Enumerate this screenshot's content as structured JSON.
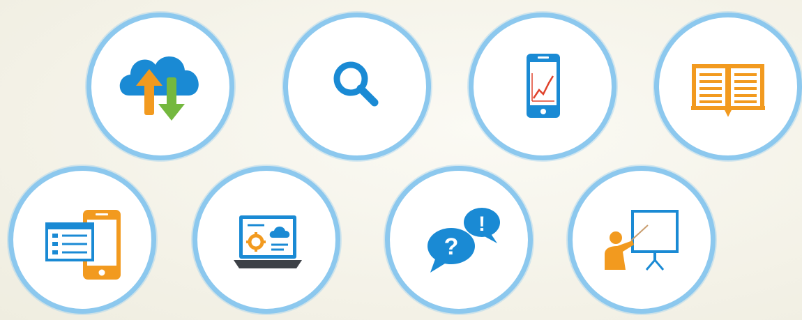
{
  "colors": {
    "background": "#f6f4ec",
    "ring": "#8cc8ee",
    "blue": "#1a8ad4",
    "orange": "#f29a1f",
    "green": "#74b83f",
    "red": "#e0422b",
    "dark": "#3d4147"
  },
  "icons": [
    {
      "name": "cloud-sync-icon"
    },
    {
      "name": "search-icon"
    },
    {
      "name": "mobile-chart-icon"
    },
    {
      "name": "book-icon"
    },
    {
      "name": "mobile-tablet-icon"
    },
    {
      "name": "laptop-settings-icon"
    },
    {
      "name": "chat-bubbles-icon"
    },
    {
      "name": "presentation-icon"
    }
  ]
}
